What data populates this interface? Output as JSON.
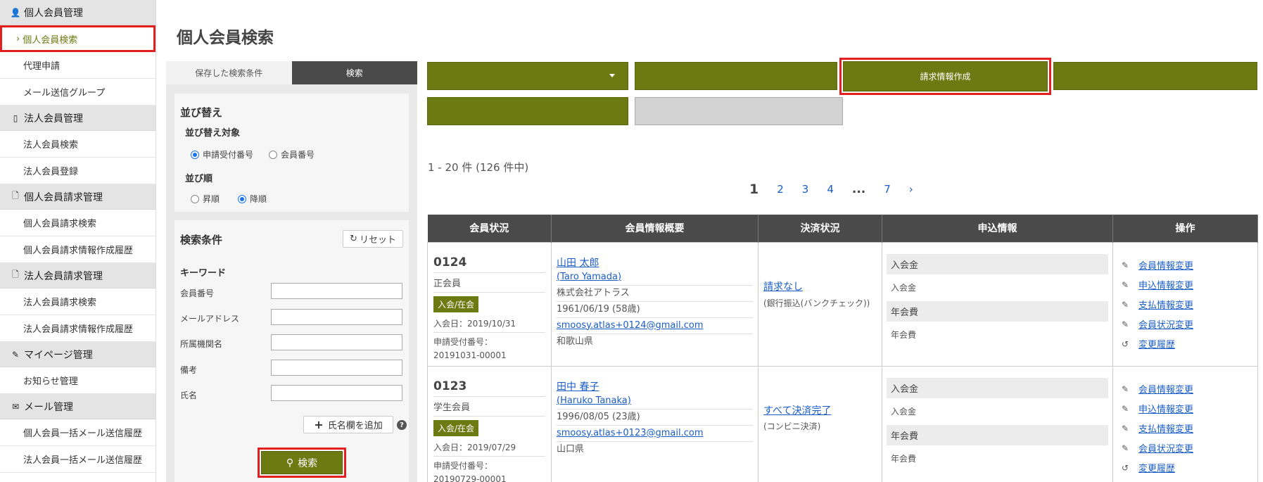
{
  "sidebar": {
    "sections": [
      {
        "icon": "user-icon",
        "label": "個人会員管理",
        "items": [
          "個人会員検索",
          "代理申請",
          "メール送信グループ"
        ]
      },
      {
        "icon": "building-icon",
        "label": "法人会員管理",
        "items": [
          "法人会員検索",
          "法人会員登録"
        ]
      },
      {
        "icon": "document-icon",
        "label": "個人会員請求管理",
        "items": [
          "個人会員請求検索",
          "個人会員請求情報作成履歴"
        ]
      },
      {
        "icon": "document-icon",
        "label": "法人会員請求管理",
        "items": [
          "法人会員請求検索",
          "法人会員請求情報作成履歴"
        ]
      },
      {
        "icon": "pen-icon",
        "label": "マイページ管理",
        "items": [
          "お知らせ管理"
        ]
      },
      {
        "icon": "mail-icon",
        "label": "メール管理",
        "items": [
          "個人会員一括メール送信履歴",
          "法人会員一括メール送信履歴"
        ]
      }
    ]
  },
  "page": {
    "title": "個人会員検索"
  },
  "search_panel": {
    "tabs": {
      "saved": "保存した検索条件",
      "search": "検索"
    },
    "sort": {
      "heading": "並び替え",
      "target_label": "並び替え対象",
      "target_options": [
        "申請受付番号",
        "会員番号"
      ],
      "order_label": "並び順",
      "order_options": [
        "昇順",
        "降順"
      ]
    },
    "conditions": {
      "heading": "検索条件",
      "reset": "リセット",
      "keyword": "キーワード",
      "fields": [
        "会員番号",
        "メールアドレス",
        "所属機関名",
        "備考",
        "氏名"
      ],
      "add_name": "氏名欄を追加",
      "help": "?",
      "search_button": "検索"
    }
  },
  "actions": {
    "create_billing": "請求情報作成"
  },
  "results": {
    "count": "1 - 20 件 (126 件中)",
    "pagination": {
      "current": "1",
      "pages": [
        "2",
        "3",
        "4"
      ],
      "dots": "...",
      "last": "7",
      "next": "›"
    },
    "columns": [
      "会員状況",
      "会員情報概要",
      "決済状況",
      "申込情報",
      "操作"
    ],
    "rows": [
      {
        "member_no": "0124",
        "type": "正会員",
        "status": "入会/在会",
        "joined": "入会日：2019/10/31",
        "app_label": "申請受付番号：",
        "app_no": "20191031-00001",
        "name": "山田 太郎",
        "name_en": "(Taro Yamada)",
        "org": "株式会社アトラス",
        "birth": "1961/06/19 (58歳)",
        "email": "smoosy.atlas+0124@gmail.com",
        "pref": "和歌山県",
        "payment": "請求なし",
        "payment_note": "(銀行振込(バンクチェック))",
        "apply": [
          {
            "h": "入会金",
            "v": "入会金"
          },
          {
            "h": "年会費",
            "v": "年会費"
          }
        ]
      },
      {
        "member_no": "0123",
        "type": "学生会員",
        "status": "入会/在会",
        "joined": "入会日：2019/07/29",
        "app_label": "申請受付番号：",
        "app_no": "20190729-00001",
        "name": "田中 春子",
        "name_en": "(Haruko Tanaka)",
        "org": "",
        "birth": "1996/08/05 (23歳)",
        "email": "smoosy.atlas+0123@gmail.com",
        "pref": "山口県",
        "payment": "すべて決済完了",
        "payment_note": "(コンビニ決済)",
        "apply": [
          {
            "h": "入会金",
            "v": "入会金"
          },
          {
            "h": "年会費",
            "v": "年会費"
          }
        ]
      }
    ],
    "ops": [
      "会員情報変更",
      "申込情報変更",
      "支払情報変更",
      "会員状況変更",
      "変更履歴"
    ]
  },
  "colors": {
    "accent": "#6c7a12",
    "highlight": "#e2201f",
    "link": "#1a5ec5"
  }
}
